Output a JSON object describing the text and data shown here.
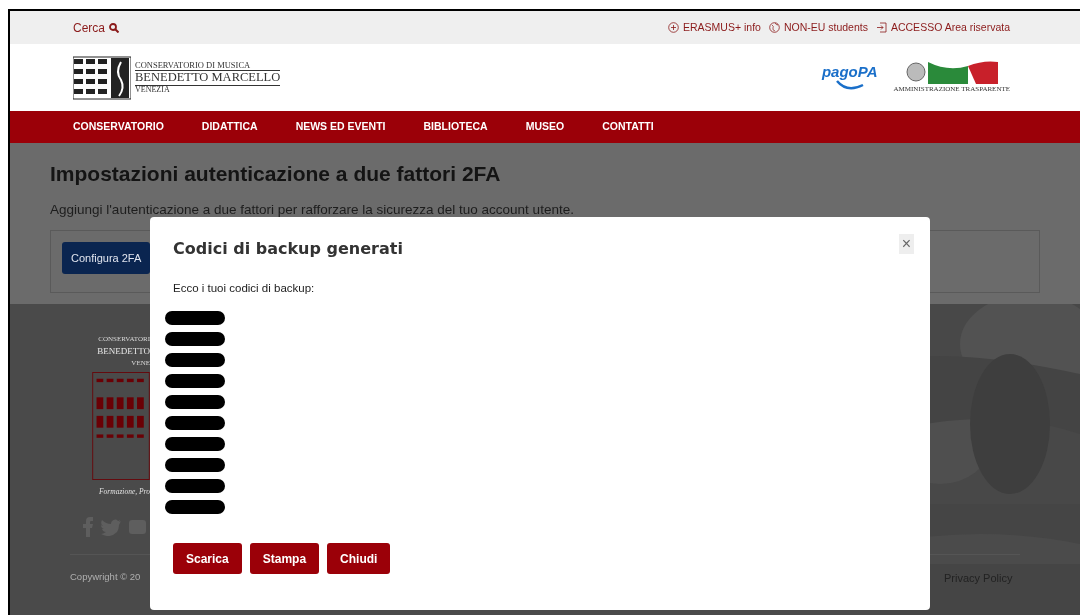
{
  "top_bar": {
    "search": "Cerca",
    "links": [
      {
        "kind": "plus",
        "label": "ERASMUS+ info"
      },
      {
        "kind": "globe",
        "label": "NON-EU students"
      },
      {
        "kind": "login",
        "label": "ACCESSO Area riservata"
      }
    ]
  },
  "header": {
    "logo": {
      "line_1": "CONSERVATORIO DI MUSICA",
      "line_2": "BENEDETTO MARCELLO",
      "line_3": "VENEZIA"
    },
    "pagopa": "pagoPA",
    "trasparenza": "AMMINISTRAZIONE TRASPARENTE"
  },
  "nav": [
    "CONSERVATORIO",
    "DIDATTICA",
    "NEWS ED EVENTI",
    "BIBLIOTECA",
    "MUSEO",
    "CONTATTI"
  ],
  "page": {
    "title": "Impostazioni autenticazione a due fattori 2FA",
    "subtitle": "Aggiungi l'autenticazione a due fattori per rafforzare la sicurezza del tuo account utente.",
    "button": "Configura 2FA"
  },
  "footer": {
    "logo_top": "CONSERVATORI",
    "logo_name": "BENEDETTO",
    "logo_bottom": "VENE",
    "motto": "Formazione, Pro",
    "copyright": "Copywright © 20",
    "privacy": "Privacy Policy"
  },
  "modal": {
    "title": "Codici di backup generati",
    "close": "×",
    "intro": "Ecco i tuoi codici di backup:",
    "codes": [
      {
        "redacted": true
      },
      {
        "redacted": true
      },
      {
        "redacted": true
      },
      {
        "redacted": true
      },
      {
        "redacted": true
      },
      {
        "redacted": true
      },
      {
        "redacted": true
      },
      {
        "redacted": true
      },
      {
        "redacted": true
      },
      {
        "redacted": true
      }
    ],
    "buttons": [
      "Scarica",
      "Stampa",
      "Chiudi"
    ]
  }
}
